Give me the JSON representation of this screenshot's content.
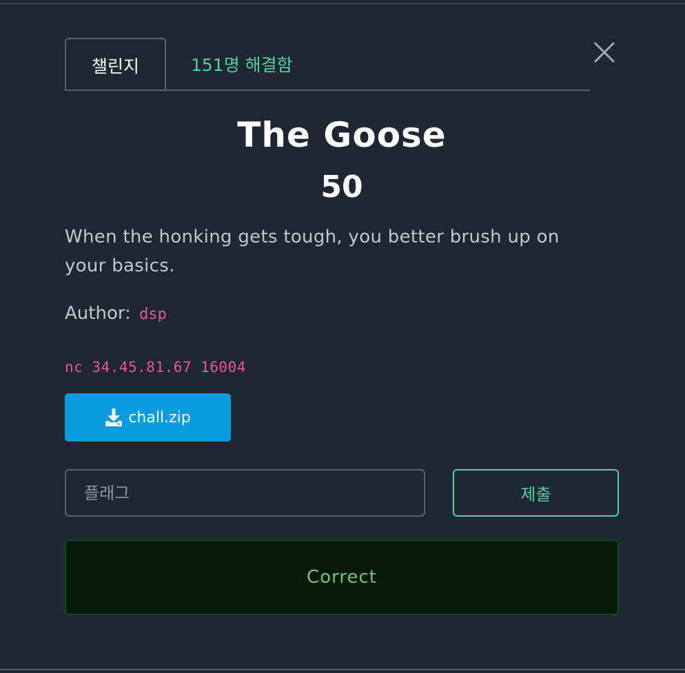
{
  "tabs": {
    "challenge_label": "챌린지",
    "solves_label": "151명 해결함"
  },
  "challenge": {
    "name": "The Goose",
    "points": "50",
    "description": "When the honking gets tough, you better brush up on your basics.",
    "author_label": "Author:",
    "author_name": "dsp",
    "connection": "nc 34.45.81.67 16004"
  },
  "download": {
    "label": "chall.zip",
    "icon": "download-icon"
  },
  "flag_form": {
    "placeholder": "플래그",
    "submit_label": "제출"
  },
  "result": {
    "message": "Correct"
  },
  "colors": {
    "background": "#1f2733",
    "accent_green": "#4fd1a5",
    "accent_pink": "#e8559e",
    "download_blue": "#089bde",
    "success_bg": "#041b09",
    "success_text": "#78c276"
  }
}
